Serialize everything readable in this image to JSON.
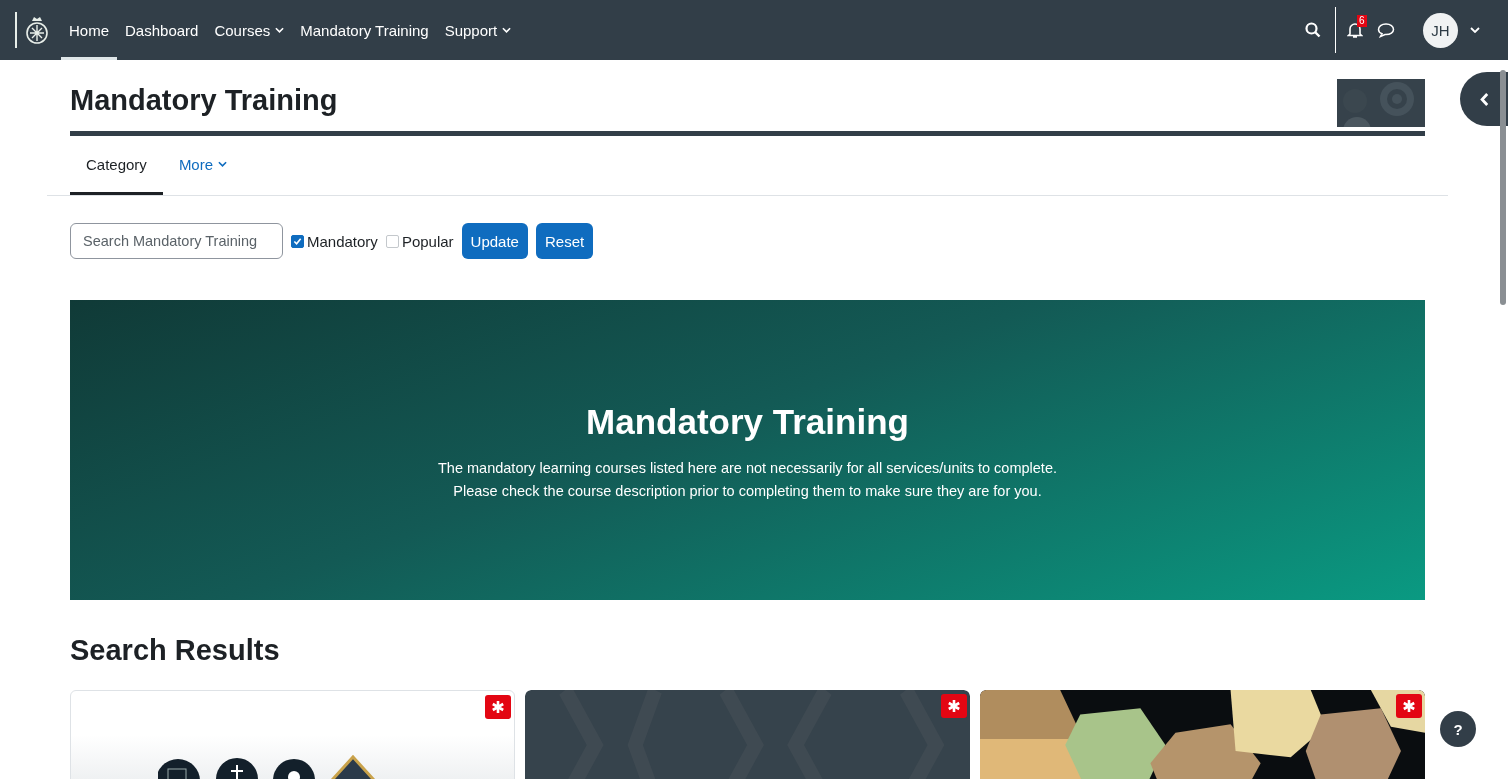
{
  "navbar": {
    "items": [
      {
        "label": "Home",
        "selected": true,
        "dropdown": false
      },
      {
        "label": "Dashboard",
        "selected": false,
        "dropdown": false
      },
      {
        "label": "Courses",
        "selected": false,
        "dropdown": true
      },
      {
        "label": "Mandatory Training",
        "selected": false,
        "dropdown": false
      },
      {
        "label": "Support",
        "selected": false,
        "dropdown": true
      }
    ],
    "notification_count": "6",
    "avatar_initials": "JH"
  },
  "page": {
    "title": "Mandatory Training"
  },
  "tabs": [
    {
      "label": "Category",
      "selected": true,
      "dropdown": false
    },
    {
      "label": "More",
      "selected": false,
      "dropdown": true
    }
  ],
  "search": {
    "placeholder": "Search Mandatory Training"
  },
  "filters": [
    {
      "label": "Mandatory",
      "checked": true
    },
    {
      "label": "Popular",
      "checked": false
    }
  ],
  "buttons": [
    "Update",
    "Reset"
  ],
  "hero": {
    "title": "Mandatory Training",
    "lines": [
      "The mandatory learning courses listed here are not necessarily for all services/units to complete.",
      "Please check the course description prior to completing them to make sure they are for you."
    ]
  },
  "results": {
    "heading": "Search Results",
    "cards": [
      {
        "kind": "emblems",
        "mandatory": true
      },
      {
        "kind": "dark",
        "mandatory": true
      },
      {
        "kind": "hexagons",
        "mandatory": true
      }
    ]
  },
  "help": {
    "label": "?"
  }
}
